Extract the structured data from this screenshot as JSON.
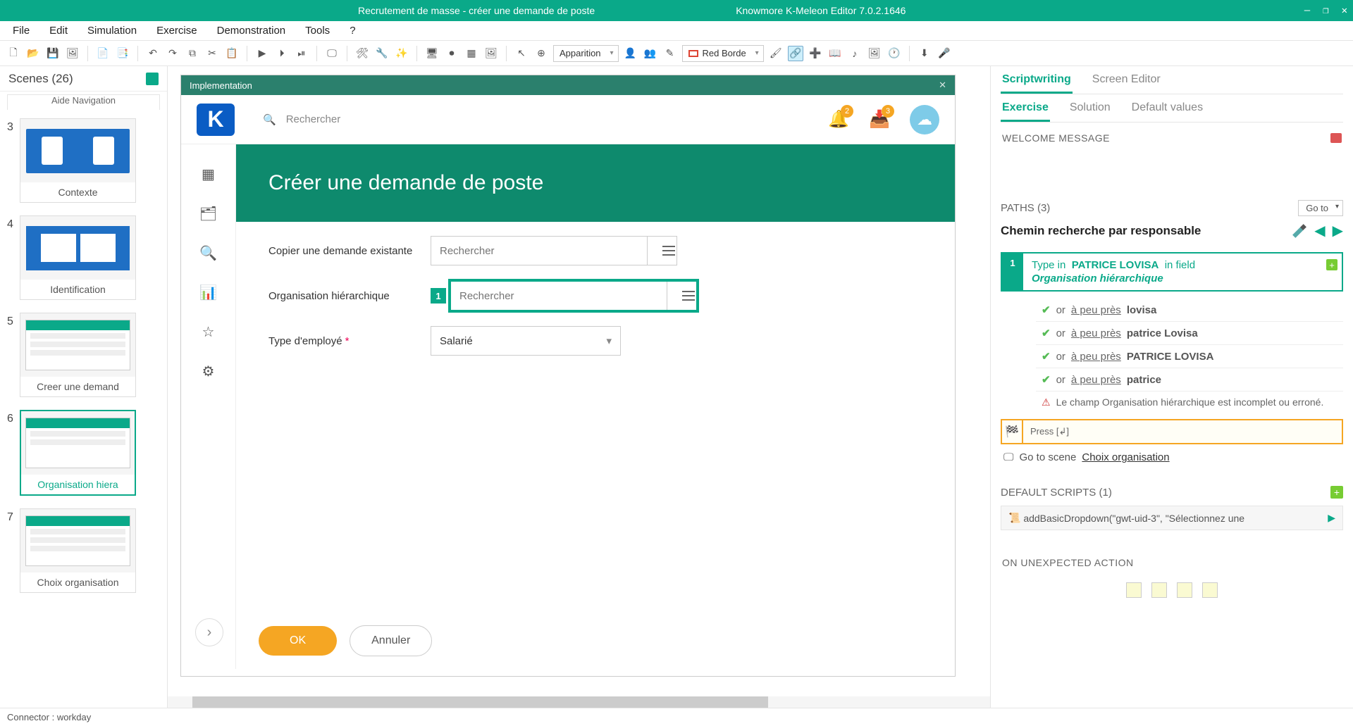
{
  "titlebar": {
    "doc": "Recrutement de masse - créer une demande de poste",
    "app": "Knowmore K-Meleon Editor 7.0.2.1646"
  },
  "menu": {
    "items": [
      "File",
      "Edit",
      "Simulation",
      "Exercise",
      "Demonstration",
      "Tools",
      "?"
    ]
  },
  "toolbar": {
    "apparition": "Apparition",
    "redborder": "Red Borde"
  },
  "scenes": {
    "header": "Scenes (26)",
    "cut_label": "Aide Navigation",
    "items": [
      {
        "n": "3",
        "label": "Contexte"
      },
      {
        "n": "4",
        "label": "Identification"
      },
      {
        "n": "5",
        "label": "Creer une demand"
      },
      {
        "n": "6",
        "label": "Organisation hiera",
        "active": true
      },
      {
        "n": "7",
        "label": "Choix organisation"
      }
    ]
  },
  "impl": {
    "title": "Implementation",
    "search_placeholder": "Rechercher",
    "notif_count": "2",
    "inbox_count": "3",
    "banner": "Créer une demande de poste",
    "row1_label": "Copier une demande existante",
    "row1_placeholder": "Rechercher",
    "row2_label": "Organisation hiérarchique",
    "row2_marker": "1",
    "row2_placeholder": "Rechercher",
    "row3_label": "Type d'employé",
    "row3_value": "Salarié",
    "ok": "OK",
    "cancel": "Annuler"
  },
  "rpanel": {
    "tabs1": {
      "a": "Scriptwriting",
      "b": "Screen Editor"
    },
    "tabs2": {
      "a": "Exercise",
      "b": "Solution",
      "c": "Default values"
    },
    "welcome": "WELCOME MESSAGE",
    "paths_head": "PATHS (3)",
    "goto": "Go to",
    "path_name": "Chemin recherche par responsable",
    "step": {
      "n": "1",
      "prefix": "Type in",
      "value": "PATRICE LOVISA",
      "suffix": "in field",
      "field": "Organisation hiérarchique"
    },
    "alts": [
      {
        "or": "or",
        "kw": "à peu près",
        "val": "lovisa"
      },
      {
        "or": "or",
        "kw": "à peu près",
        "val": "patrice Lovisa"
      },
      {
        "or": "or",
        "kw": "à peu près",
        "val": "PATRICE LOVISA"
      },
      {
        "or": "or",
        "kw": "à peu près",
        "val": "patrice"
      }
    ],
    "warn": "Le champ Organisation hiérarchique est incomplet ou erroné.",
    "press": "Press [↲]",
    "goto_scene_lbl": "Go to scene",
    "goto_scene_val": "Choix organisation",
    "default_scripts": "DEFAULT SCRIPTS (1)",
    "ds_item": "addBasicDropdown(\"gwt-uid-3\", \"Sélectionnez une",
    "unexpected": "ON UNEXPECTED ACTION"
  },
  "status": "Connector :  workday"
}
